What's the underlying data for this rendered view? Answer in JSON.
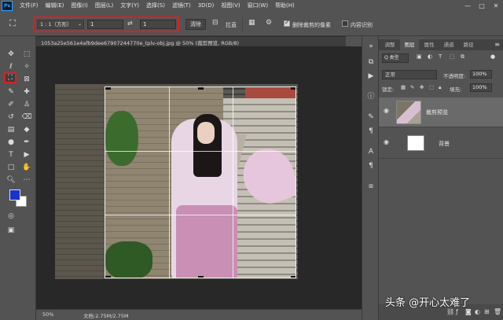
{
  "menubar": {
    "logo": "Ps",
    "items": [
      "文件(F)",
      "编辑(E)",
      "图像(I)",
      "图层(L)",
      "文字(Y)",
      "选择(S)",
      "滤镜(T)",
      "3D(D)",
      "视图(V)",
      "窗口(W)",
      "帮助(H)"
    ],
    "controls": [
      "—",
      "□",
      "✕"
    ]
  },
  "options": {
    "ratio": "1 : 1（方形）",
    "width_value": "1",
    "height_value": "1",
    "clear_label": "清除",
    "straighten_label": "拉直",
    "delete_cropped_label": "删除裁剪的像素",
    "delete_cropped_checked": true,
    "content_aware_label": "内容识别",
    "content_aware_checked": false
  },
  "document": {
    "tab_title": "1053a25e561e4afb9dee67907244770e_tplv-obj.jpg @ 50% (裁剪预览, RGB/8)",
    "close": "×"
  },
  "status": {
    "zoom": "50%",
    "doc_size": "文档:2.75M/2.75M"
  },
  "colors": {
    "foreground": "#1733c8",
    "background": "#ffffff",
    "highlight": "#e01e1e"
  },
  "panel": {
    "tabs": [
      "调整",
      "图层",
      "属性",
      "通道",
      "路径"
    ],
    "active_tab": 1,
    "filter_kind": "Q 类型",
    "blend_mode": "正常",
    "opacity_label": "不透明度:",
    "opacity_value": "100%",
    "lock_label": "锁定:",
    "fill_label": "填充:",
    "fill_value": "100%",
    "layers": [
      {
        "name": "裁剪预览",
        "selected": true
      },
      {
        "name": "背景",
        "selected": false
      }
    ]
  },
  "watermark": "头条 @开心太难了"
}
